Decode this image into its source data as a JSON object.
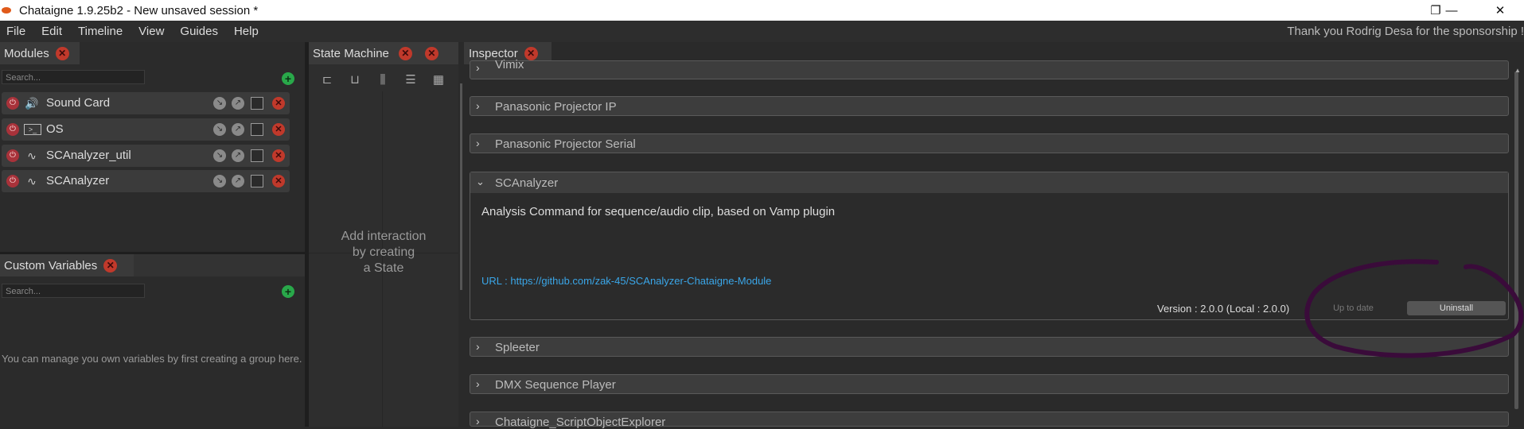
{
  "window": {
    "title": "Chataigne 1.9.25b2 - New unsaved session *",
    "controls": {
      "minimize": "—",
      "maximize": "❐",
      "close": "✕"
    }
  },
  "menu": [
    "File",
    "Edit",
    "Timeline",
    "View",
    "Guides",
    "Help"
  ],
  "sponsor_text": "Thank you Rodrig Desa for the sponsorship !",
  "modules_panel": {
    "title": "Modules",
    "search_placeholder": "Search...",
    "items": [
      {
        "name": "Sound Card",
        "icon": "speaker-icon"
      },
      {
        "name": "OS",
        "icon": "terminal-icon"
      },
      {
        "name": "SCAnalyzer_util",
        "icon": "waveform-icon"
      },
      {
        "name": "SCAnalyzer",
        "icon": "waveform-icon"
      }
    ]
  },
  "custom_variables_panel": {
    "title": "Custom Variables",
    "search_placeholder": "Search...",
    "empty_message": "You can manage you own variables by first creating a group here."
  },
  "state_machine_panel": {
    "title": "State Machine",
    "placeholder": "Add interaction\nby creating\na State"
  },
  "inspector": {
    "title": "Inspector",
    "rows_above": [
      "Vimix",
      "Panasonic Projector IP",
      "Panasonic Projector Serial"
    ],
    "expanded": {
      "name": "SCAnalyzer",
      "description": "Analysis Command for sequence/audio clip, based on Vamp plugin",
      "url_prefix": "URL : ",
      "url": "https://github.com/zak-45/SCAnalyzer-Chataigne-Module",
      "version_text": "Version : 2.0.0 (Local : 2.0.0)",
      "status_button": "Up to date",
      "uninstall_button": "Uninstall"
    },
    "rows_below": [
      "Spleeter",
      "DMX Sequence Player",
      "Chataigne_ScriptObjectExplorer"
    ]
  },
  "colors": {
    "annotation_stroke": "#3a0b3a",
    "close_red": "#c0392b",
    "add_green": "#29a84a",
    "link_blue": "#3aa6e8"
  }
}
